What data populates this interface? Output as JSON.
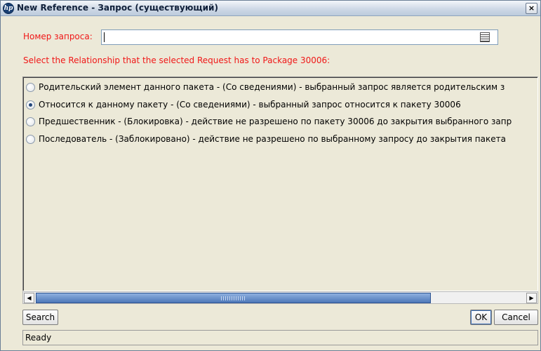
{
  "window": {
    "title": "New Reference - Запрос (существующий)",
    "logo": "hp",
    "close_label": "×"
  },
  "form": {
    "request_number_label": "Номер запроса:",
    "request_number_value": "",
    "relationship_prompt": "Select the Relationship that the selected Request has to Package 30006:"
  },
  "options": [
    {
      "label": "Родительский элемент данного пакета - (Со сведениями) - выбранный запрос является родительским з",
      "selected": false
    },
    {
      "label": "Относится к данному пакету - (Со сведениями) - выбранный запрос относится к пакету 30006",
      "selected": true
    },
    {
      "label": "Предшественник - (Блокировка) - действие не разрешено по пакету 30006 до закрытия выбранного запр",
      "selected": false
    },
    {
      "label": "Последователь - (Заблокировано) - действие не разрешено по выбранному запросу до закрытия пакета",
      "selected": false
    }
  ],
  "buttons": {
    "search": "Search",
    "ok": "OK",
    "cancel": "Cancel"
  },
  "status": {
    "text": "Ready"
  },
  "scrollbar": {
    "left_arrow": "◀",
    "right_arrow": "▶"
  },
  "colors": {
    "label_red": "#f01717",
    "window_bg": "#ece9d8",
    "scroll_thumb": "#4e78b8"
  }
}
